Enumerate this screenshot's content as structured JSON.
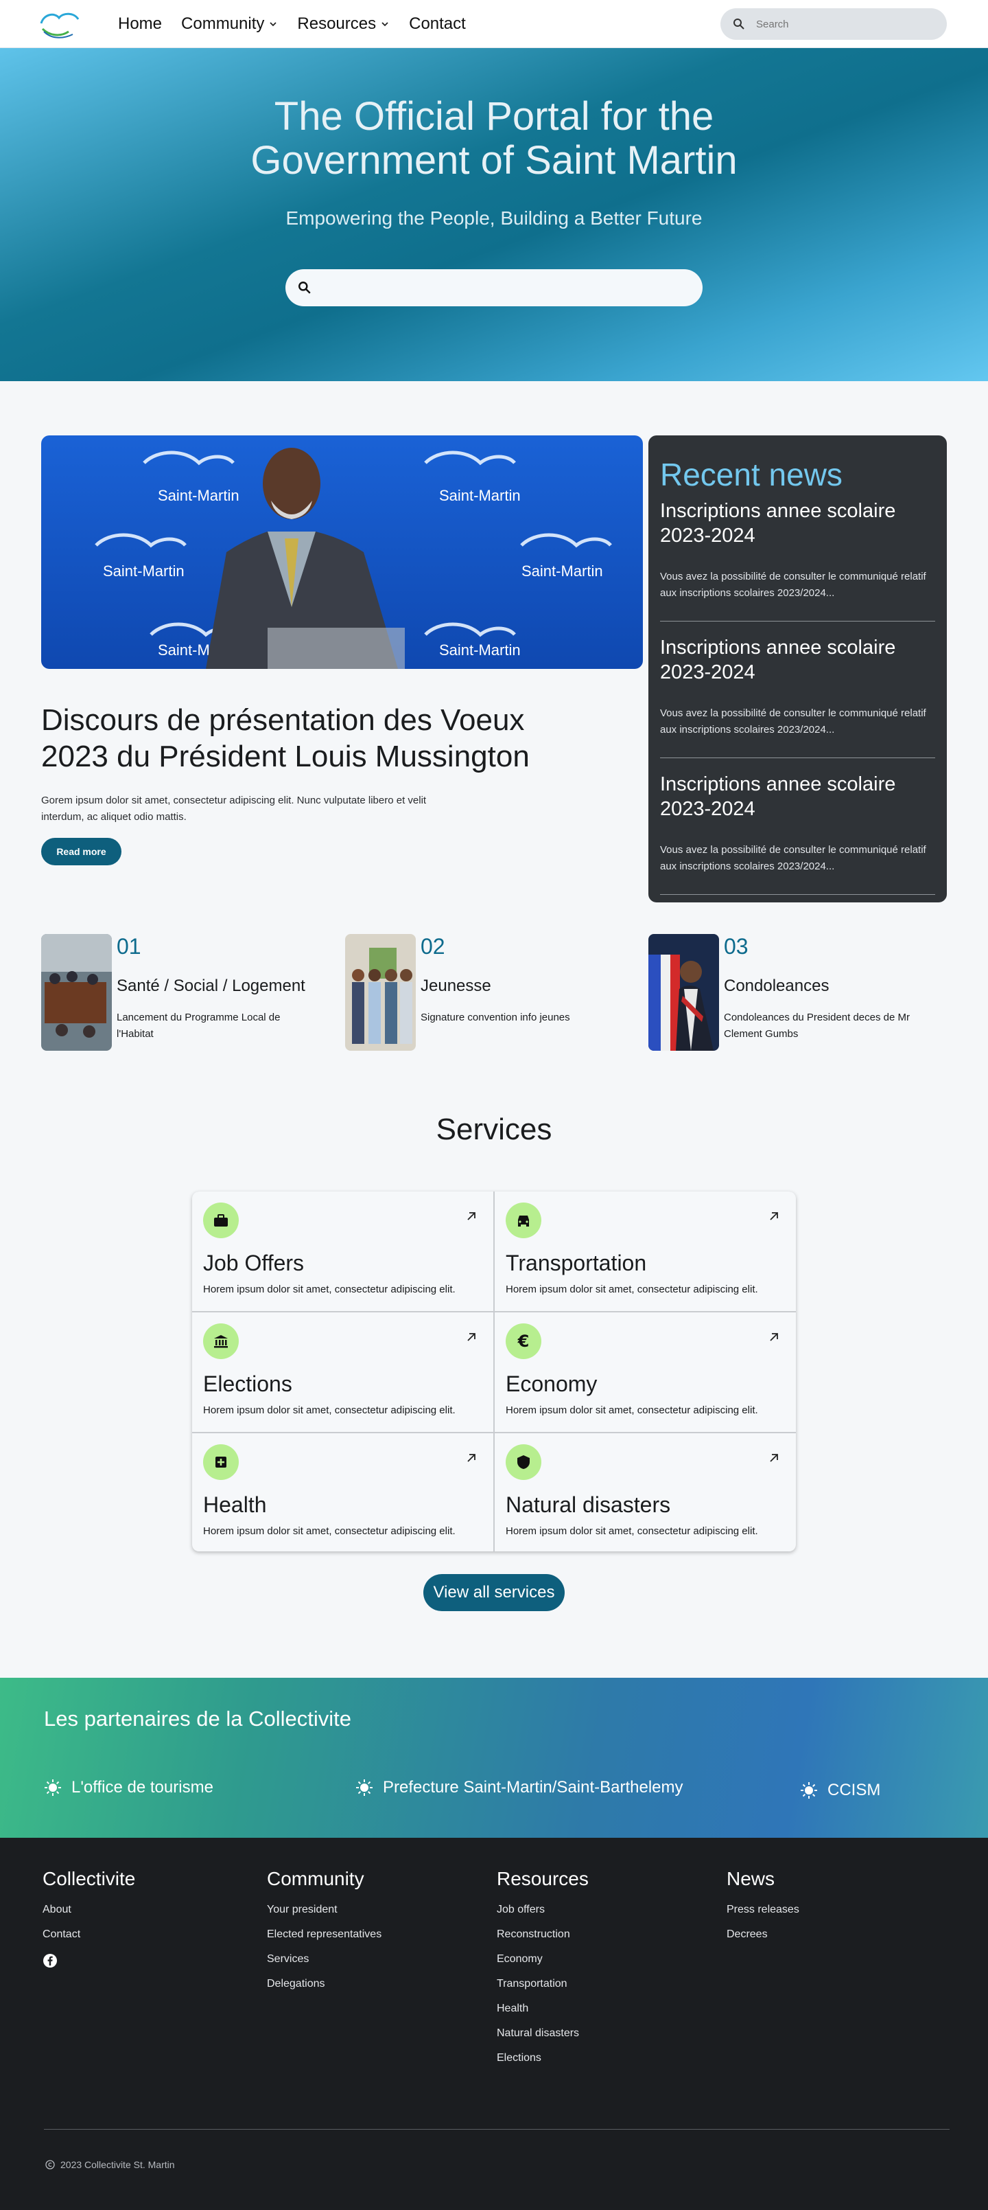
{
  "nav": {
    "logo_text": "Saint-Martin",
    "links": [
      {
        "label": "Home",
        "has_dropdown": false
      },
      {
        "label": "Community",
        "has_dropdown": true
      },
      {
        "label": "Resources",
        "has_dropdown": true
      },
      {
        "label": "Contact",
        "has_dropdown": false
      }
    ],
    "search_placeholder": "Search"
  },
  "hero": {
    "title_line1": "The Official Portal for the",
    "title_line2": "Government of Saint Martin",
    "subtitle": "Empowering the People, Building a Better Future",
    "search_value": ""
  },
  "feature": {
    "image_alt_text": "Saint-Martin",
    "title": "Discours de présentation des Voeux 2023 du Président Louis Mussington",
    "text": "Gorem ipsum dolor sit amet, consectetur adipiscing elit. Nunc vulputate libero et velit interdum, ac aliquet odio mattis.",
    "button_label": "Read more"
  },
  "recent_news": {
    "heading": "Recent news",
    "items": [
      {
        "title": "Inscriptions annee scolaire 2023-2024",
        "excerpt": "Vous avez la possibilité de consulter le communiqué relatif aux inscriptions scolaires 2023/2024..."
      },
      {
        "title": "Inscriptions annee scolaire 2023-2024",
        "excerpt": "Vous avez la possibilité de consulter le communiqué relatif aux inscriptions scolaires 2023/2024..."
      },
      {
        "title": "Inscriptions annee scolaire 2023-2024",
        "excerpt": "Vous avez la possibilité de consulter le communiqué relatif aux inscriptions scolaires 2023/2024..."
      }
    ]
  },
  "cards": [
    {
      "number": "01",
      "category": "Santé / Social / Logement",
      "description": "Lancement du Programme Local de l'Habitat"
    },
    {
      "number": "02",
      "category": "Jeunesse",
      "description": "Signature convention info jeunes"
    },
    {
      "number": "03",
      "category": "Condoleances",
      "description": "Condoleances du President deces de Mr Clement Gumbs"
    }
  ],
  "services": {
    "title": "Services",
    "items": [
      {
        "label": "Job Offers",
        "description": "Horem ipsum dolor sit amet, consectetur adipiscing elit.",
        "icon": "briefcase-icon"
      },
      {
        "label": "Transportation",
        "description": "Horem ipsum dolor sit amet, consectetur adipiscing elit.",
        "icon": "car-icon"
      },
      {
        "label": "Elections",
        "description": "Horem ipsum dolor sit amet, consectetur adipiscing elit.",
        "icon": "institution-icon"
      },
      {
        "label": "Economy",
        "description": "Horem ipsum dolor sit amet, consectetur adipiscing elit.",
        "icon": "euro-icon"
      },
      {
        "label": "Health",
        "description": "Horem ipsum dolor sit amet, consectetur adipiscing elit.",
        "icon": "medical-icon"
      },
      {
        "label": "Natural disasters",
        "description": "Horem ipsum dolor sit amet, consectetur adipiscing elit.",
        "icon": "shield-icon"
      }
    ],
    "view_all_label": "View all services",
    "accent_color": "#b7ee8f",
    "button_color": "#0e5f7d"
  },
  "partners": {
    "heading": "Les partenaires de la Collectivite",
    "items": [
      "L'office de tourisme",
      "Prefecture Saint-Martin/Saint-Barthelemy",
      "CCISM"
    ]
  },
  "footer": {
    "columns": [
      {
        "heading": "Collectivite",
        "links": [
          "About",
          "Contact"
        ]
      },
      {
        "heading": "Community",
        "links": [
          "Your president",
          "Elected representatives",
          "Services",
          "Delegations"
        ]
      },
      {
        "heading": "Resources",
        "links": [
          "Job offers",
          "Reconstruction",
          "Economy",
          "Transportation",
          "Health",
          "Natural disasters",
          "Elections"
        ]
      },
      {
        "heading": "News",
        "links": [
          "Press releases",
          "Decrees"
        ]
      }
    ],
    "copyright": "2023 Collectivite St. Martin"
  }
}
